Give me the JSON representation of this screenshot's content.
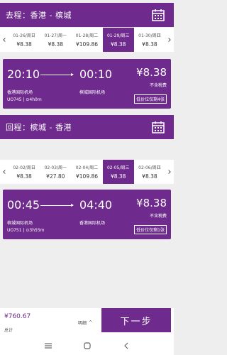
{
  "outbound": {
    "title": "去程：香港 - 槟城",
    "dates": [
      {
        "date": "01-26/周日",
        "price": "¥8.38",
        "selected": false
      },
      {
        "date": "01-27/周一",
        "price": "¥8.38",
        "selected": false
      },
      {
        "date": "01-28/周二",
        "price": "¥109.86",
        "selected": false
      },
      {
        "date": "01-29/周三",
        "price": "¥8.38",
        "selected": true
      },
      {
        "date": "01-30/周四",
        "price": "¥8.38",
        "selected": false
      }
    ],
    "flight": {
      "dep_time": "20:10",
      "arr_time": "00:10",
      "dep_airport": "香港国际机场",
      "arr_airport": "槟城国际机场",
      "flight_info": "UO745 | ⊙4h0m",
      "price": "¥8.38",
      "tax_note": "不含税费",
      "low_price": "低价位仅剩4张"
    }
  },
  "return": {
    "title": "回程：槟城 - 香港",
    "dates": [
      {
        "date": "02-02/周日",
        "price": "¥8.38",
        "selected": false
      },
      {
        "date": "02-03/周一",
        "price": "¥27.80",
        "selected": false
      },
      {
        "date": "02-04/周二",
        "price": "¥109.86",
        "selected": false
      },
      {
        "date": "02-05/周三",
        "price": "¥8.38",
        "selected": true
      },
      {
        "date": "02-06/周四",
        "price": "¥8.38",
        "selected": false
      }
    ],
    "flight": {
      "dep_time": "00:45",
      "arr_time": "04:40",
      "dep_airport": "槟城国际机场",
      "arr_airport": "香港国际机场",
      "flight_info": "UO751 | ⊙3h55m",
      "price": "¥8.38",
      "tax_note": "不含税费",
      "low_price": "低价位仅剩1张"
    }
  },
  "footer": {
    "total_price": "¥760.67",
    "total_label": "总计",
    "detail_label": "明细",
    "detail_icon": "chevron-up-icon",
    "next_label": "下一步"
  },
  "icons": {
    "calendar": "calendar-icon",
    "prev": "chevron-left-icon",
    "next": "chevron-right-icon",
    "nav_menu": "menu-icon",
    "nav_home": "home-icon",
    "nav_back": "back-icon"
  },
  "colors": {
    "brand": "#6e2a8c",
    "background": "#eeeeee"
  }
}
